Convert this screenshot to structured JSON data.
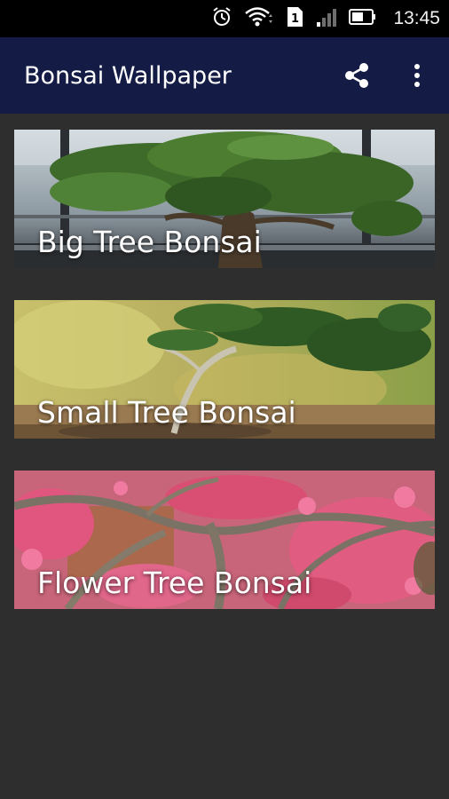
{
  "status_bar": {
    "time": "13:45",
    "sim_label": "1",
    "icons": [
      "alarm-icon",
      "wifi-icon",
      "sim-icon",
      "signal-icon",
      "battery-icon"
    ]
  },
  "app_bar": {
    "title": "Bonsai Wallpaper",
    "actions": [
      "share-icon",
      "more-vert-icon"
    ],
    "background_color": "#141b45"
  },
  "categories": [
    {
      "label": "Big Tree Bonsai",
      "image": "big-tree-bonsai-image"
    },
    {
      "label": "Small Tree Bonsai",
      "image": "small-tree-bonsai-image"
    },
    {
      "label": "Flower Tree Bonsai",
      "image": "flower-tree-bonsai-image"
    }
  ],
  "colors": {
    "status_bar": "#000000",
    "page_background": "#2e2e2e",
    "label_text": "#ffffff"
  }
}
